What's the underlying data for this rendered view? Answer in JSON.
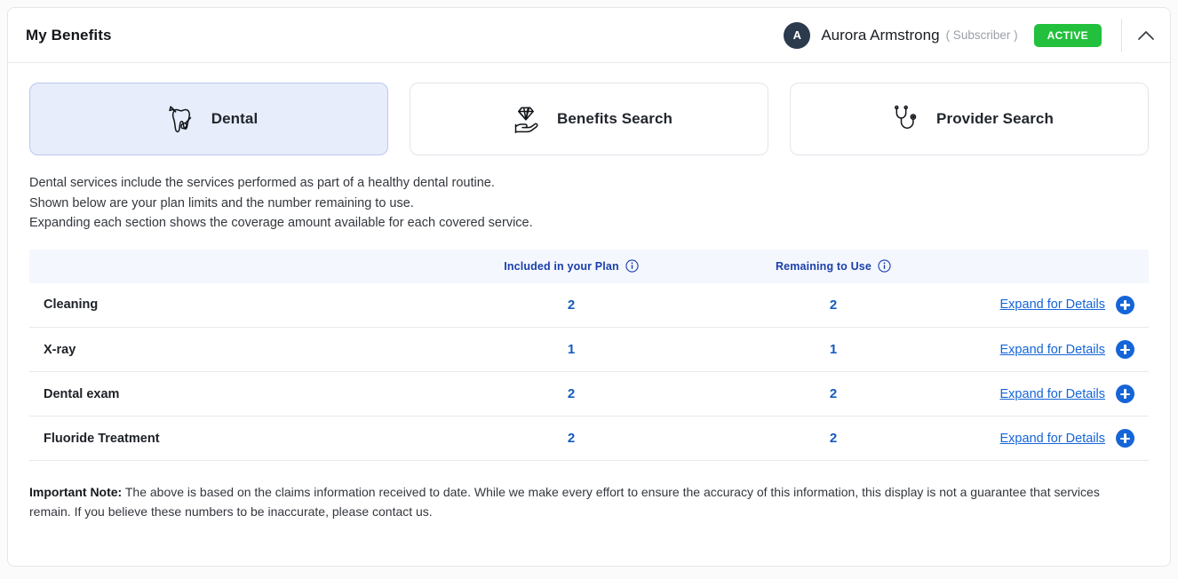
{
  "header": {
    "title": "My Benefits",
    "member_initial": "A",
    "member_name": "Aurora Armstrong",
    "member_role": "( Subscriber )",
    "status": "ACTIVE",
    "status_color": "#22c03c",
    "collapse_icon": "chevron-up-icon"
  },
  "tabs": [
    {
      "label": "Dental",
      "icon": "tooth-icon",
      "selected": true
    },
    {
      "label": "Benefits Search",
      "icon": "hand-diamond-icon",
      "selected": false
    },
    {
      "label": "Provider Search",
      "icon": "stethoscope-icon",
      "selected": false
    }
  ],
  "description": {
    "line1": "Dental services include the services performed as part of a healthy dental routine.",
    "line2": "Shown below are your plan limits and the number remaining to use.",
    "line3": "Expanding each section shows the coverage amount available for each covered service."
  },
  "table": {
    "columns": {
      "service": "",
      "included": "Included in your Plan",
      "remaining": "Remaining to Use",
      "action": ""
    },
    "info_icon": "info-circle-icon",
    "expand_label": "Expand for Details",
    "expand_icon": "plus-circle-icon",
    "rows": [
      {
        "service": "Cleaning",
        "included": "2",
        "remaining": "2"
      },
      {
        "service": "X-ray",
        "included": "1",
        "remaining": "1"
      },
      {
        "service": "Dental exam",
        "included": "2",
        "remaining": "2"
      },
      {
        "service": "Fluoride Treatment",
        "included": "2",
        "remaining": "2"
      }
    ]
  },
  "note": {
    "label": "Important Note:",
    "text": " The above is based on the claims information received to date. While we make every effort to ensure the accuracy of this information, this display is not a guarantee that services remain. If you believe these numbers to be inaccurate, please contact us."
  },
  "colors": {
    "link": "#1565d8",
    "header_text": "#1a3faa",
    "value": "#145bbf",
    "selected_tab_bg": "#e8edfb"
  }
}
